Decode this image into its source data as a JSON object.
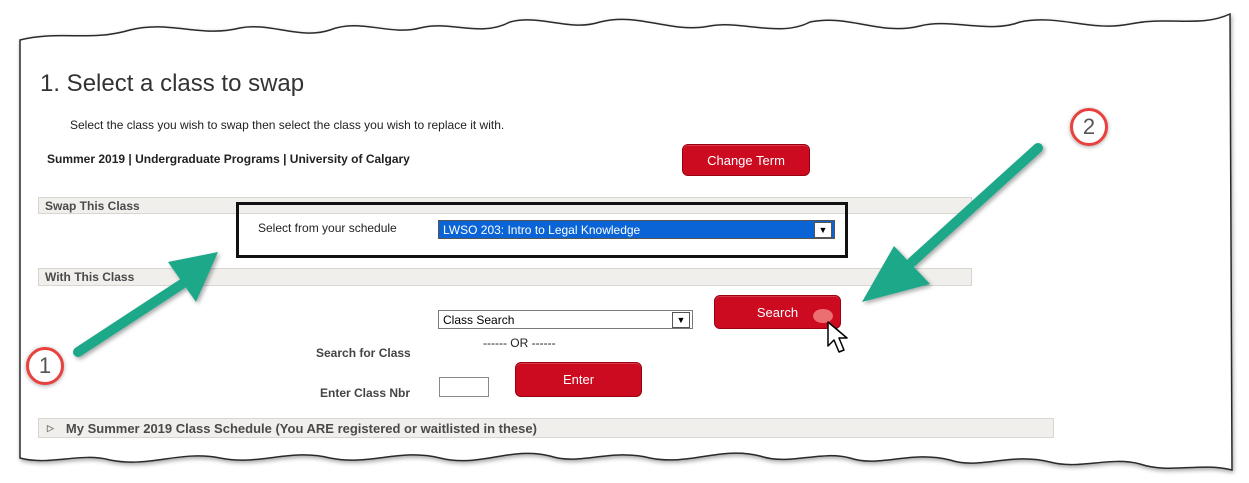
{
  "page": {
    "title": "1.  Select a class to swap",
    "instructions": "Select the class you wish to swap then select the class you wish to replace it with.",
    "term_info": "Summer 2019 | Undergraduate Programs | University of Calgary",
    "change_term_label": "Change Term"
  },
  "swap_section": {
    "header": "Swap This Class",
    "select_label": "Select from your schedule",
    "selected_value": "LWSO 203: Intro to Legal Knowledge"
  },
  "with_section": {
    "header": "With This Class",
    "search_select_value": "Class Search",
    "search_button_label": "Search",
    "search_for_class_label": "Search for Class",
    "or_text": "------ OR ------",
    "enter_class_nbr_label": "Enter Class Nbr",
    "enter_button_label": "Enter"
  },
  "schedule_section": {
    "label": "My Summer 2019 Class Schedule (You ARE registered or waitlisted in these)"
  },
  "callouts": {
    "one": "1",
    "two": "2"
  },
  "colors": {
    "button_red": "#cc0a20",
    "arrow_teal": "#1fa889",
    "callout_red": "#e9413d",
    "selection_blue": "#0a64d6"
  },
  "icons": {
    "dropdown": "chevron-down-icon",
    "expand": "triangle-right-icon",
    "cursor": "pointer-cursor-icon",
    "arrow": "annotation-arrow-icon"
  }
}
